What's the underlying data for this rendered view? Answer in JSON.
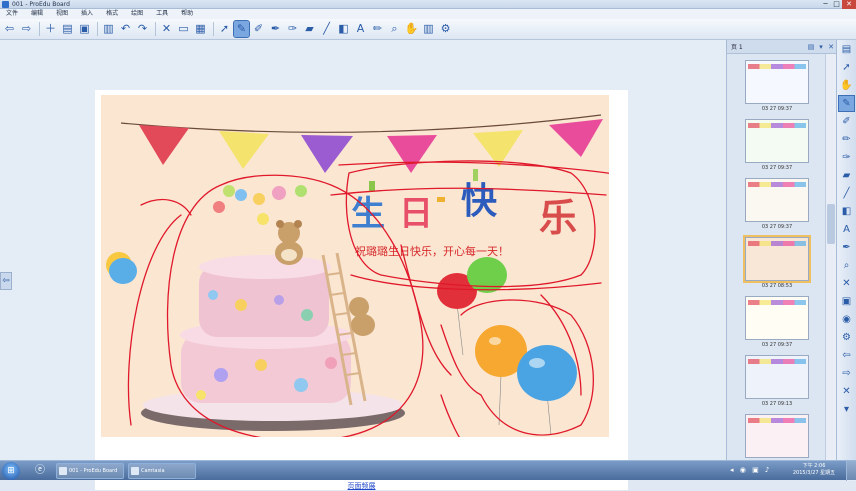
{
  "window": {
    "title": "001 - ProEdu Board",
    "min_glyph": "─",
    "max_glyph": "□",
    "close_glyph": "✕"
  },
  "menu": [
    "文件",
    "编辑",
    "视图",
    "插入",
    "格式",
    "绘图",
    "工具",
    "帮助"
  ],
  "toolbar": {
    "buttons": [
      {
        "name": "back-icon",
        "glyph": "⇦"
      },
      {
        "name": "forward-icon",
        "glyph": "⇨"
      },
      {
        "name": "new-page-icon",
        "glyph": "＋"
      },
      {
        "name": "open-folder-icon",
        "glyph": "▤"
      },
      {
        "name": "save-icon",
        "glyph": "▣"
      },
      {
        "name": "paste-icon",
        "glyph": "▥"
      },
      {
        "name": "undo-icon",
        "glyph": "↶"
      },
      {
        "name": "redo-icon",
        "glyph": "↷"
      },
      {
        "name": "delete-icon",
        "glyph": "✕"
      },
      {
        "name": "screen-shade-icon",
        "glyph": "▭"
      },
      {
        "name": "display-icon",
        "glyph": "▦"
      },
      {
        "name": "select-arrow-icon",
        "glyph": "➚"
      },
      {
        "name": "pen-icon",
        "glyph": "✎"
      },
      {
        "name": "highlighter-icon",
        "glyph": "✐"
      },
      {
        "name": "creative-pen-icon",
        "glyph": "✒"
      },
      {
        "name": "brush-icon",
        "glyph": "✑"
      },
      {
        "name": "eraser-icon",
        "glyph": "▰"
      },
      {
        "name": "line-icon",
        "glyph": "╱"
      },
      {
        "name": "shape-icon",
        "glyph": "◧"
      },
      {
        "name": "text-icon",
        "glyph": "A"
      },
      {
        "name": "fill-icon",
        "glyph": "✏"
      },
      {
        "name": "zoom-icon",
        "glyph": "⌕"
      },
      {
        "name": "hand-icon",
        "glyph": "✋"
      },
      {
        "name": "table-icon",
        "glyph": "▥"
      },
      {
        "name": "properties-icon",
        "glyph": "⚙"
      }
    ]
  },
  "left_tab_glyph": "⇦",
  "slide": {
    "greeting": "祝璐璐生日快乐，开心每一天！",
    "title_chars": [
      "生",
      "日",
      "快",
      "乐"
    ],
    "footer_link": "页面频展"
  },
  "panel": {
    "title": "页 1",
    "thumbnails": [
      {
        "caption": "03 27 09:37",
        "bg": "#f6f8ff"
      },
      {
        "caption": "03 27 09:37",
        "bg": "#f4fbf2"
      },
      {
        "caption": "03 27 09:37",
        "bg": "#fbf8f1"
      },
      {
        "caption": "03 27 08:53",
        "bg": "#f8e6d6"
      },
      {
        "caption": "03 27 09:37",
        "bg": "#fffdf4"
      },
      {
        "caption": "03 27 09:13",
        "bg": "#eef2fa"
      },
      {
        "caption": "",
        "bg": "#fbf1f4"
      }
    ]
  },
  "side_tools": [
    {
      "name": "pages-icon",
      "glyph": "▤"
    },
    {
      "name": "arrow-icon",
      "glyph": "➚"
    },
    {
      "name": "hand-icon",
      "glyph": "✋"
    },
    {
      "name": "pen-icon",
      "glyph": "✎"
    },
    {
      "name": "highlighter-icon",
      "glyph": "✐"
    },
    {
      "name": "pencil-icon",
      "glyph": "✏"
    },
    {
      "name": "brush-icon",
      "glyph": "✑"
    },
    {
      "name": "eraser-icon",
      "glyph": "▰"
    },
    {
      "name": "line-icon",
      "glyph": "╱"
    },
    {
      "name": "shape-icon",
      "glyph": "◧"
    },
    {
      "name": "text-icon",
      "glyph": "A"
    },
    {
      "name": "fill-icon",
      "glyph": "✒"
    },
    {
      "name": "magnifier-icon",
      "glyph": "⌕"
    },
    {
      "name": "eraser-all-icon",
      "glyph": "✕"
    },
    {
      "name": "screenshot-icon",
      "glyph": "▣"
    },
    {
      "name": "record-icon",
      "glyph": "◉"
    },
    {
      "name": "settings-icon",
      "glyph": "⚙"
    },
    {
      "name": "back-page-icon",
      "glyph": "⇦"
    },
    {
      "name": "next-page-icon",
      "glyph": "⇨"
    },
    {
      "name": "close-icon",
      "glyph": "✕"
    },
    {
      "name": "more-icon",
      "glyph": "▾"
    }
  ],
  "taskbar": {
    "start_glyph": "⊞",
    "items": [
      {
        "label": "001 - ProEdu Board"
      },
      {
        "label": "Camtasia"
      }
    ],
    "tray_glyphs": "◂ ◉ ▣ ♪",
    "clock_time": "下午 2:06",
    "clock_date": "2015/3/27 星期五"
  },
  "colors": {
    "accent": "#2f6fc9",
    "ink": "#e0182a",
    "cake_bg": "#fbe6d2"
  }
}
